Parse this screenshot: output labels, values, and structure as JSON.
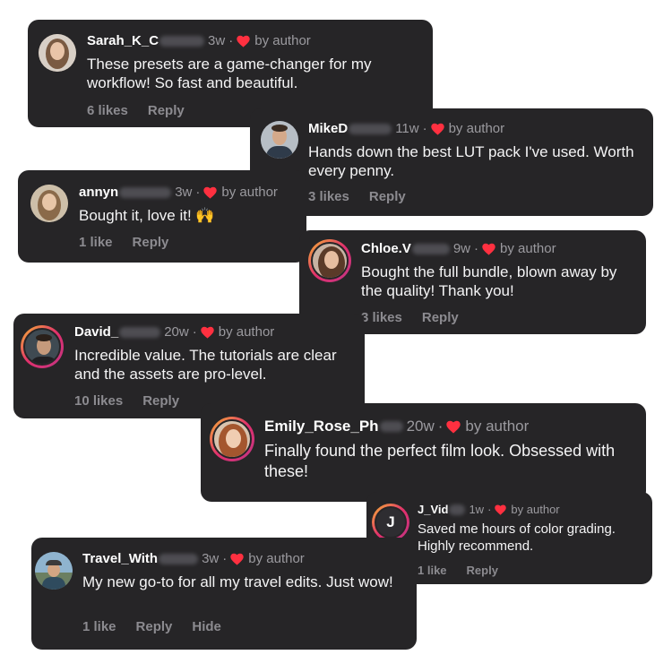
{
  "comments": [
    {
      "username": "Sarah_K_C",
      "time": "3w",
      "separator": "·",
      "by_author": "by author",
      "text": "These presets are a game-changer for my workflow! So fast and beautiful.",
      "likes": "6 likes",
      "reply": "Reply"
    },
    {
      "username": "MikeD",
      "time": "11w",
      "separator": "·",
      "by_author": "by author",
      "text": "Hands down the best LUT pack I've used. Worth every penny.",
      "likes": "3 likes",
      "reply": "Reply"
    },
    {
      "username": "annyn",
      "time": "3w",
      "separator": "·",
      "by_author": "by author",
      "text": "Bought it, love it! 🙌",
      "likes": "1 like",
      "reply": "Reply"
    },
    {
      "username": "Chloe.V",
      "time": "9w",
      "separator": "·",
      "by_author": "by author",
      "text": "Bought the full bundle, blown away by the quality! Thank you!",
      "likes": "3 likes",
      "reply": "Reply"
    },
    {
      "username": "David_",
      "time": "20w",
      "separator": "·",
      "by_author": "by author",
      "text": "Incredible value. The tutorials are clear and the assets are pro-level.",
      "likes": "10 likes",
      "reply": "Reply"
    },
    {
      "username": "Emily_Rose_Ph",
      "time": "20w",
      "separator": "·",
      "by_author": "by author",
      "text": "Finally found the perfect film look. Obsessed with these!",
      "likes": "",
      "reply": ""
    },
    {
      "username": "J_Vid",
      "avatar_letter": "J",
      "time": "1w",
      "separator": "·",
      "by_author": "by author",
      "text": "Saved me hours of color grading. Highly recommend.",
      "likes": "1 like",
      "reply": "Reply"
    },
    {
      "username": "Travel_With",
      "time": "3w",
      "separator": "·",
      "by_author": "by author",
      "text": "My new go-to for all my travel edits. Just wow!",
      "likes": "1 like",
      "reply": "Reply",
      "hide": "Hide"
    }
  ],
  "icons": {
    "heart": "heart-icon",
    "heart_color": "#ff3040"
  },
  "colors": {
    "card_bg": "#262527",
    "muted": "#9b9a9f",
    "story_ring": "gradient-orange-pink"
  }
}
